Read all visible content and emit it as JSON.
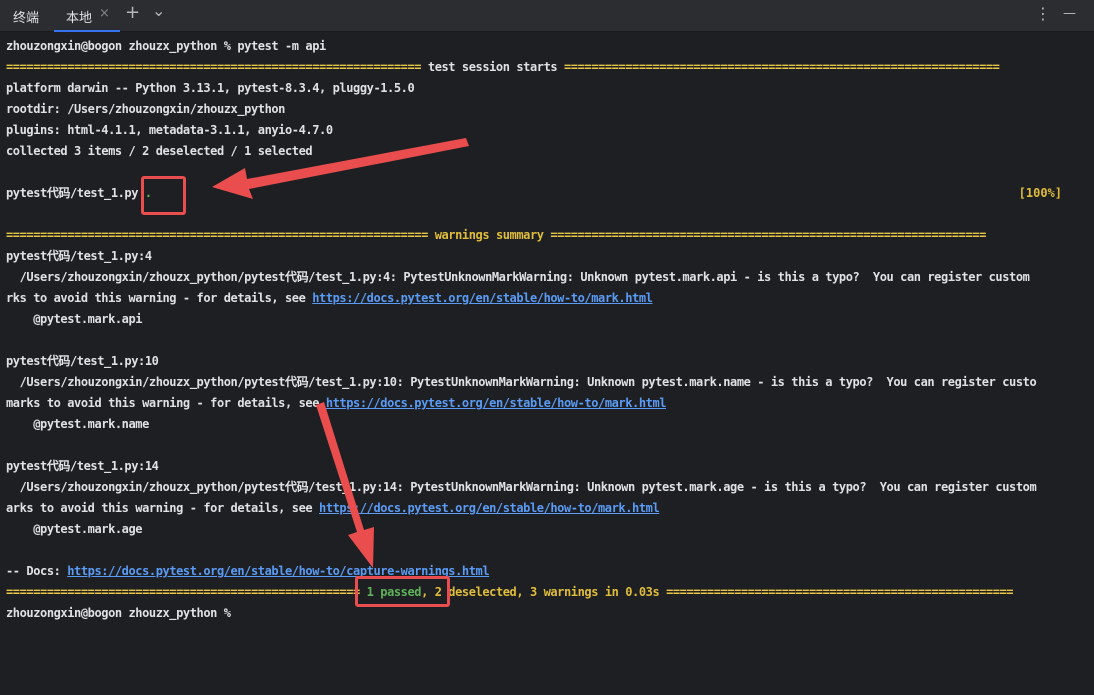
{
  "tabs": {
    "title": "终端",
    "active_label": "本地",
    "close_glyph": "×",
    "add_glyph": "+",
    "dropdown_glyph": "⌄",
    "more_glyph": "⋮",
    "minimize_glyph": "—"
  },
  "terminal": {
    "command_line": "zhouzongxin@bogon zhouzx_python % pytest -m api",
    "session_sep_left": "============================================================= ",
    "session_title": "test session starts",
    "session_sep_right": " ================================================================",
    "platform": "platform darwin -- Python 3.13.1, pytest-8.3.4, pluggy-1.5.0",
    "rootdir": "rootdir: /Users/zhouzongxin/zhouzx_python",
    "plugins": "plugins: html-4.1.1, metadata-3.1.1, anyio-4.7.0",
    "collected": "collected 3 items / 2 deselected / 1 selected",
    "test_file": "pytest代码/test_1.py",
    "test_result": " .",
    "test_percent": "[100%]",
    "warn_sep_left": "============================================================== ",
    "warn_title": "warnings summary",
    "warn_sep_right": " ================================================================",
    "w1_loc": "pytest代码/test_1.py:4",
    "w1_msg": "  /Users/zhouzongxin/zhouzx_python/pytest代码/test_1.py:4: PytestUnknownMarkWarning: Unknown pytest.mark.api - is this a typo?  You can register custom",
    "w1_cont": "rks to avoid this warning - for details, see ",
    "w1_link": "https://docs.pytest.org/en/stable/how-to/mark.html",
    "w1_code": "    @pytest.mark.api",
    "w2_loc": "pytest代码/test_1.py:10",
    "w2_msg": "  /Users/zhouzongxin/zhouzx_python/pytest代码/test_1.py:10: PytestUnknownMarkWarning: Unknown pytest.mark.name - is this a typo?  You can register custo",
    "w2_cont": "marks to avoid this warning - for details, see ",
    "w2_link": "https://docs.pytest.org/en/stable/how-to/mark.html",
    "w2_code": "    @pytest.mark.name",
    "w3_loc": "pytest代码/test_1.py:14",
    "w3_msg": "  /Users/zhouzongxin/zhouzx_python/pytest代码/test_1.py:14: PytestUnknownMarkWarning: Unknown pytest.mark.age - is this a typo?  You can register custom",
    "w3_cont": "arks to avoid this warning - for details, see ",
    "w3_link": "https://docs.pytest.org/en/stable/how-to/mark.html",
    "w3_code": "    @pytest.mark.age",
    "docs_prefix": "-- Docs: ",
    "docs_link": "https://docs.pytest.org/en/stable/how-to/capture-warnings.html",
    "sum_sep_left": "==================================================== ",
    "sum_passed": "1 passed",
    "sum_comma": ", ",
    "sum_deselected": "2 deselected",
    "sum_comma2": ", ",
    "sum_warnings": "3 warnings in 0.03s",
    "sum_sep_right": " ===================================================",
    "prompt": "zhouzongxin@bogon zhouzx_python %"
  },
  "colors": {
    "background": "#1e1f22",
    "text": "#dfe1e5",
    "yellow": "#e0bd3a",
    "green": "#5fb15a",
    "link": "#5a9bf5",
    "annotation": "#ea4d4d"
  }
}
